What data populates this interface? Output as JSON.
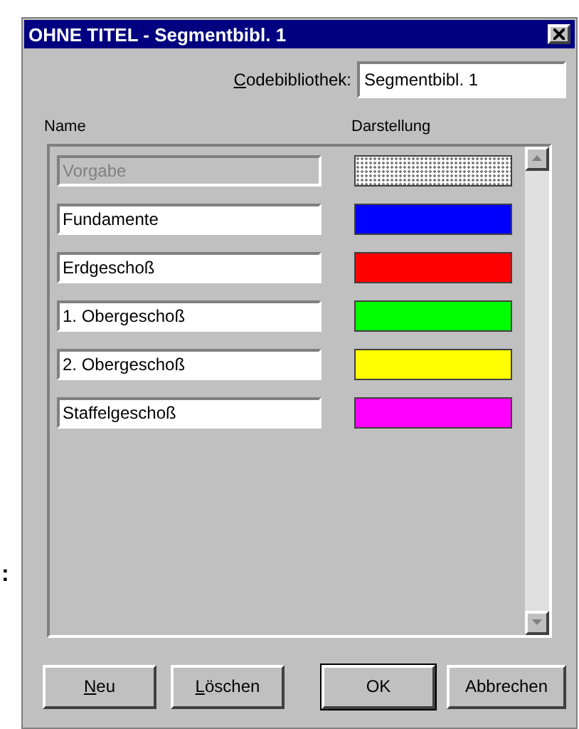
{
  "background_text": ":",
  "window": {
    "title": "OHNE TITEL - Segmentbibl. 1"
  },
  "library": {
    "label": "Codebibliothek:",
    "accelerator": true,
    "value": "Segmentbibl. 1"
  },
  "columns": [
    "Name",
    "Darstellung"
  ],
  "rows": [
    {
      "name": "Vorgabe",
      "disabled": true,
      "kind": "pattern"
    },
    {
      "name": "Fundamente",
      "disabled": false,
      "kind": "solid",
      "color": "#0000ff"
    },
    {
      "name": "Erdgeschoß",
      "disabled": false,
      "kind": "solid",
      "color": "#ff0000"
    },
    {
      "name": "1. Obergeschoß",
      "disabled": false,
      "kind": "solid",
      "color": "#00ff00"
    },
    {
      "name": "2. Obergeschoß",
      "disabled": false,
      "kind": "solid",
      "color": "#ffff00"
    },
    {
      "name": "Staffelgeschoß",
      "disabled": false,
      "kind": "solid",
      "color": "#ff00ff"
    }
  ],
  "buttons": [
    {
      "label": "Neu",
      "accelerator": true,
      "default": false
    },
    {
      "label": "Löschen",
      "accelerator": true,
      "default": false
    },
    {
      "label": "OK",
      "accelerator": false,
      "default": true
    },
    {
      "label": "Abbrechen",
      "accelerator": false,
      "default": false
    }
  ]
}
